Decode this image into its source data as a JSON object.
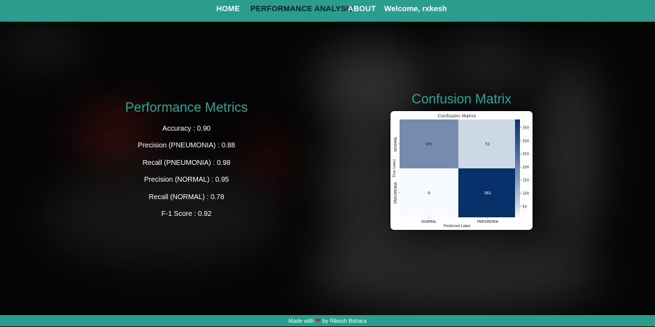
{
  "nav": {
    "home": "HOME",
    "performance": "PERFORMANCE ANALYSIS",
    "about": "ABOUT",
    "welcome": "Welcome, rxkesh"
  },
  "metrics": {
    "title": "Performance Metrics",
    "items": [
      "Accuracy : 0.90",
      "Precision (PNEUMONIA) : 0.88",
      "Recall (PNEUMONIA) : 0.98",
      "Precision (NORMAL) : 0.95",
      "Recall (NORMAL) : 0.78",
      "F-1 Score : 0.92"
    ]
  },
  "confusion": {
    "heading": "Confusion Matrix"
  },
  "chart_data": {
    "type": "heatmap",
    "title": "Confusion Matrix",
    "xlabel": "Predicted Label",
    "ylabel": "True Label",
    "x_categories": [
      "NORMAL",
      "PNEUMONIA"
    ],
    "y_categories": [
      "NORMAL",
      "PNEUMONIA"
    ],
    "values": [
      [
        183,
        51
      ],
      [
        9,
        381
      ]
    ],
    "colorbar_ticks": [
      50,
      100,
      150,
      200,
      250,
      300,
      350
    ],
    "colorbar_range": [
      9,
      381
    ],
    "colormap": [
      "#f7fbff",
      "#08306b"
    ]
  },
  "footer": {
    "made_with": "Made with",
    "by": "by Rikesh Bohara"
  }
}
